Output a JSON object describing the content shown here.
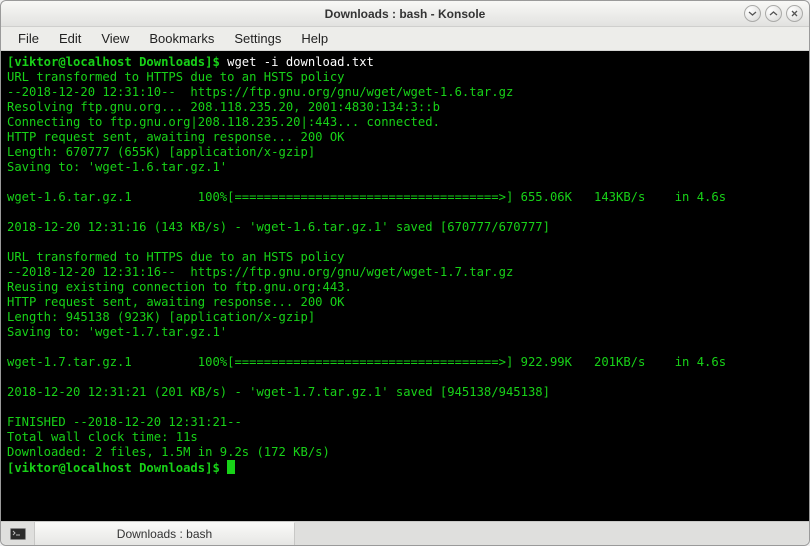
{
  "window": {
    "title": "Downloads : bash - Konsole"
  },
  "menubar": {
    "items": [
      "File",
      "Edit",
      "View",
      "Bookmarks",
      "Settings",
      "Help"
    ]
  },
  "terminal": {
    "prompt_user": "[viktor@localhost Downloads]$ ",
    "command": "wget -i download.txt",
    "lines": [
      "URL transformed to HTTPS due to an HSTS policy",
      "--2018-12-20 12:31:10--  https://ftp.gnu.org/gnu/wget/wget-1.6.tar.gz",
      "Resolving ftp.gnu.org... 208.118.235.20, 2001:4830:134:3::b",
      "Connecting to ftp.gnu.org|208.118.235.20|:443... connected.",
      "HTTP request sent, awaiting response... 200 OK",
      "Length: 670777 (655K) [application/x-gzip]",
      "Saving to: 'wget-1.6.tar.gz.1'",
      "",
      "wget-1.6.tar.gz.1         100%[====================================>] 655.06K   143KB/s    in 4.6s",
      "",
      "2018-12-20 12:31:16 (143 KB/s) - 'wget-1.6.tar.gz.1' saved [670777/670777]",
      "",
      "URL transformed to HTTPS due to an HSTS policy",
      "--2018-12-20 12:31:16--  https://ftp.gnu.org/gnu/wget/wget-1.7.tar.gz",
      "Reusing existing connection to ftp.gnu.org:443.",
      "HTTP request sent, awaiting response... 200 OK",
      "Length: 945138 (923K) [application/x-gzip]",
      "Saving to: 'wget-1.7.tar.gz.1'",
      "",
      "wget-1.7.tar.gz.1         100%[====================================>] 922.99K   201KB/s    in 4.6s",
      "",
      "2018-12-20 12:31:21 (201 KB/s) - 'wget-1.7.tar.gz.1' saved [945138/945138]",
      "",
      "FINISHED --2018-12-20 12:31:21--",
      "Total wall clock time: 11s",
      "Downloaded: 2 files, 1.5M in 9.2s (172 KB/s)"
    ],
    "prompt2_user": "[viktor@localhost Downloads]$ "
  },
  "tabstrip": {
    "tab_label": "Downloads : bash"
  }
}
